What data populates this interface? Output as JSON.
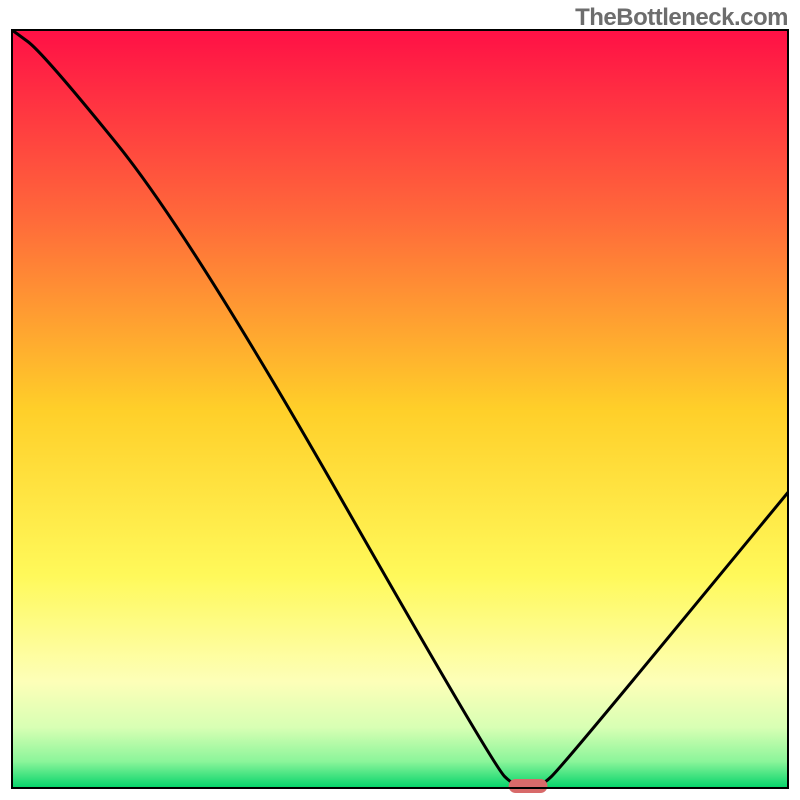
{
  "watermark": "TheBottleneck.com",
  "chart_data": {
    "type": "line",
    "title": "",
    "xlabel": "",
    "ylabel": "",
    "xlim": [
      0,
      100
    ],
    "ylim": [
      0,
      100
    ],
    "x": [
      0,
      4,
      23,
      62,
      65,
      68,
      71,
      100
    ],
    "values": [
      100,
      97,
      73,
      3,
      0,
      0,
      3,
      39
    ],
    "marker": {
      "x_start": 64,
      "x_end": 69,
      "y": 0,
      "color": "#d86a6a"
    },
    "gradient_stops": [
      {
        "offset": 0,
        "color": "#ff1046"
      },
      {
        "offset": 0.25,
        "color": "#ff6a3a"
      },
      {
        "offset": 0.5,
        "color": "#ffcf29"
      },
      {
        "offset": 0.72,
        "color": "#fff95a"
      },
      {
        "offset": 0.86,
        "color": "#fdffb8"
      },
      {
        "offset": 0.92,
        "color": "#d8ffb4"
      },
      {
        "offset": 0.965,
        "color": "#8bf59a"
      },
      {
        "offset": 1.0,
        "color": "#03d36a"
      }
    ],
    "frame_color": "#000000",
    "frame_width": 2
  }
}
